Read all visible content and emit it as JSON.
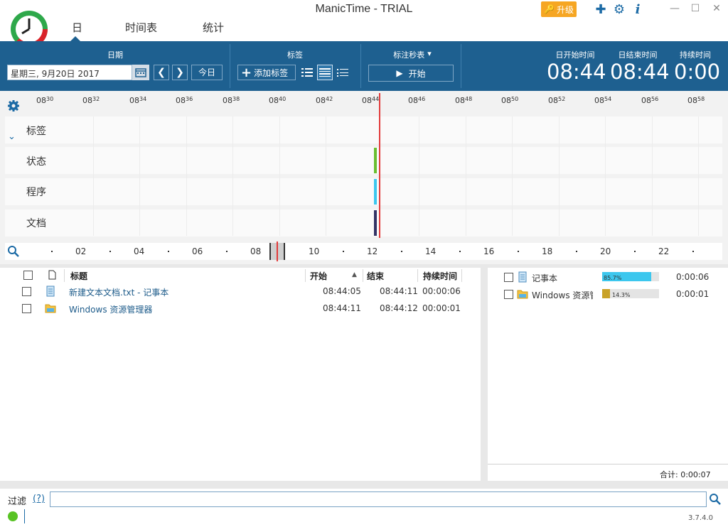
{
  "window": {
    "title": "ManicTime - TRIAL",
    "version": "3.7.4.0"
  },
  "tabs": [
    {
      "label": "日"
    },
    {
      "label": "时间表"
    },
    {
      "label": "统计"
    }
  ],
  "upgrade": {
    "label": "升级"
  },
  "toolbar": {
    "date_head": "日期",
    "date_value": "星期三, 9月20日 2017",
    "today_label": "今日",
    "tags_head": "标签",
    "add_tag_label": "添加标签",
    "stopwatch_head": "标注秒表",
    "start_label": "开始",
    "day_start_head": "日开始时间",
    "day_end_head": "日结束时间",
    "duration_head": "持续时间",
    "day_start": "08:44",
    "day_end": "08:44",
    "duration": "0:00"
  },
  "timeline": {
    "ticks": [
      {
        "h": "08",
        "m": "30"
      },
      {
        "h": "08",
        "m": "32"
      },
      {
        "h": "08",
        "m": "34"
      },
      {
        "h": "08",
        "m": "36"
      },
      {
        "h": "08",
        "m": "38"
      },
      {
        "h": "08",
        "m": "40"
      },
      {
        "h": "08",
        "m": "42"
      },
      {
        "h": "08",
        "m": "44"
      },
      {
        "h": "08",
        "m": "46"
      },
      {
        "h": "08",
        "m": "48"
      },
      {
        "h": "08",
        "m": "50"
      },
      {
        "h": "08",
        "m": "52"
      },
      {
        "h": "08",
        "m": "54"
      },
      {
        "h": "08",
        "m": "56"
      },
      {
        "h": "08",
        "m": "58"
      }
    ],
    "rows": [
      {
        "label": "标签"
      },
      {
        "label": "状态"
      },
      {
        "label": "程序"
      },
      {
        "label": "文档"
      }
    ],
    "marker_colors": {
      "status": "#6abf30",
      "program": "#3cc7ee",
      "document": "#333366"
    },
    "day_scale": [
      "02",
      "04",
      "06",
      "08",
      "10",
      "12",
      "14",
      "16",
      "18",
      "20",
      "22"
    ]
  },
  "list": {
    "headers": {
      "title": "标题",
      "start": "开始",
      "end": "结束",
      "duration": "持续时间"
    },
    "rows": [
      {
        "title": "新建文本文档.txt - 记事本",
        "start": "08:44:05",
        "end": "08:44:11",
        "duration": "00:00:06",
        "icon": "notepad-icon"
      },
      {
        "title": "Windows 资源管理器",
        "start": "08:44:11",
        "end": "08:44:12",
        "duration": "00:00:01",
        "icon": "folder-icon"
      }
    ]
  },
  "apps": {
    "rows": [
      {
        "name": "记事本",
        "percent_label": "85.7%",
        "percent": 85.7,
        "duration": "0:00:06",
        "color": "#3cc7ee",
        "icon": "notepad-icon"
      },
      {
        "name": "Windows 资源管",
        "percent_label": "14.3%",
        "percent": 14.3,
        "duration": "0:00:01",
        "color": "#c9a227",
        "icon": "folder-icon"
      }
    ],
    "total": "合计: 0:00:07"
  },
  "filter": {
    "label": "过滤",
    "help": "(?)"
  }
}
